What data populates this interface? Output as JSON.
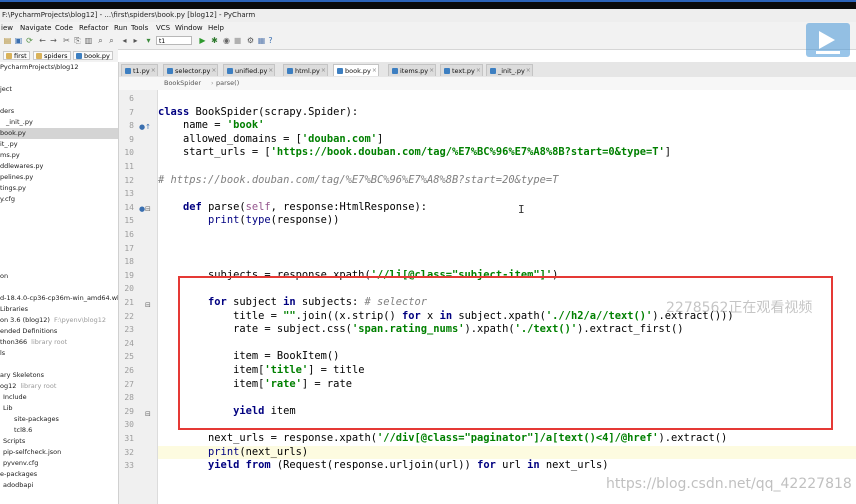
{
  "window": {
    "title": "F:\\PycharmProjects\\blog12] - ...\\first\\spiders\\book.py [blog12] - PyCharm"
  },
  "menu": [
    "iew",
    "Navigate",
    "Code",
    "Refactor",
    "Run",
    "Tools",
    "VCS",
    "Window",
    "Help"
  ],
  "toolbar": {
    "run_config": "t1"
  },
  "navbar": {
    "crumbs": [
      "first",
      "spiders",
      "book.py"
    ]
  },
  "sidebar": {
    "items": [
      {
        "text": "PycharmProjects\\blog12",
        "sel": false
      },
      {
        "text": "",
        "sel": false
      },
      {
        "text": "ject",
        "sel": false
      },
      {
        "text": "",
        "sel": false
      },
      {
        "text": "ders",
        "sel": false
      },
      {
        "text": "_init_.py",
        "sel": false
      },
      {
        "text": "book.py",
        "sel": true
      },
      {
        "text": "it_.py",
        "sel": false
      },
      {
        "text": "ms.py",
        "sel": false
      },
      {
        "text": "ddlewares.py",
        "sel": false
      },
      {
        "text": "pelines.py",
        "sel": false
      },
      {
        "text": "tings.py",
        "sel": false
      },
      {
        "text": "y.cfg",
        "sel": false
      },
      {
        "text": "",
        "sel": false
      },
      {
        "text": "",
        "sel": false
      },
      {
        "text": "",
        "sel": false
      },
      {
        "text": "",
        "sel": false
      },
      {
        "text": "",
        "sel": false
      },
      {
        "text": "",
        "sel": false
      },
      {
        "text": "on",
        "sel": false
      },
      {
        "text": "",
        "sel": false
      },
      {
        "text": "d-18.4.0-cp36-cp36m-win_amd64.wh",
        "sel": false
      },
      {
        "text": "Libraries",
        "sel": false
      },
      {
        "text": "on 3.6 (blog12)",
        "dim": "F:\\pyenv\\blog12",
        "sel": false
      },
      {
        "text": "ended Definitions",
        "sel": false
      },
      {
        "text": "thon366",
        "dim": "library root",
        "sel": false
      },
      {
        "text": "ls",
        "sel": false
      },
      {
        "text": "",
        "sel": false
      },
      {
        "text": "ary Skeletons",
        "sel": false
      },
      {
        "text": "og12",
        "dim": "library root",
        "sel": false
      },
      {
        "text": "Include",
        "sel": false
      },
      {
        "text": "Lib",
        "sel": false
      },
      {
        "text": "site-packages",
        "sel": false
      },
      {
        "text": "tcl8.6",
        "sel": false
      },
      {
        "text": "Scripts",
        "sel": false
      },
      {
        "text": "pip-selfcheck.json",
        "sel": false
      },
      {
        "text": "pyvenv.cfg",
        "sel": false
      },
      {
        "text": "e-packages",
        "sel": false
      },
      {
        "text": "adodbapi",
        "sel": false
      }
    ]
  },
  "tabs": [
    {
      "label": "t1.py",
      "active": false
    },
    {
      "label": "selector.py",
      "active": false
    },
    {
      "label": "unified.py",
      "active": false
    },
    {
      "label": "html.py",
      "active": false
    },
    {
      "label": "book.py",
      "active": true
    },
    {
      "label": "items.py",
      "active": false
    },
    {
      "label": "text.py",
      "active": false
    },
    {
      "label": "_init_.py",
      "active": false
    }
  ],
  "editor_breadcrumb": [
    "BookSpider",
    "parse()"
  ],
  "code": {
    "line_numbers": [
      "6",
      "7",
      "8",
      "9",
      "10",
      "11",
      "12",
      "13",
      "14",
      "15",
      "16",
      "17",
      "18",
      "19",
      "20",
      "21",
      "22",
      "23",
      "24",
      "25",
      "26",
      "27",
      "28",
      "29",
      "30",
      "31",
      "32",
      "33"
    ],
    "lines": [
      "",
      "class BookSpider(scrapy.Spider):",
      "    name = 'book'",
      "    allowed_domains = ['douban.com']",
      "    start_urls = ['https://book.douban.com/tag/%E7%BC%96%E7%A8%8B?start=0&type=T']",
      "",
      "# https://book.douban.com/tag/%E7%BC%96%E7%A8%8B?start=20&type=T",
      "",
      "    def parse(self, response:HtmlResponse):",
      "        print(type(response))",
      "",
      "",
      "",
      "        subjects = response.xpath('//li[@class=\"subject-item\"]')",
      "",
      "        for subject in subjects: # selector",
      "            title = \"\".join((x.strip() for x in subject.xpath('.//h2/a//text()').extract()))",
      "            rate = subject.css('span.rating_nums').xpath('./text()').extract_first()",
      "",
      "            item = BookItem()",
      "            item['title'] = title",
      "            item['rate'] = rate",
      "",
      "            yield item",
      "",
      "        next_urls = response.xpath('//div[@class=\"paginator\"]/a[text()<4]/@href').extract()",
      "        print(next_urls)",
      "        yield from (Request(response.urljoin(url)) for url in next_urls)"
    ]
  },
  "overlay": {
    "viewers": "2278562正在观看视频",
    "watermark": "https://blog.csdn.net/qq_42227818"
  },
  "colors": {
    "keyword": "#000080",
    "string": "#008000",
    "comment": "#808080",
    "highlight_box": "#e53935"
  }
}
